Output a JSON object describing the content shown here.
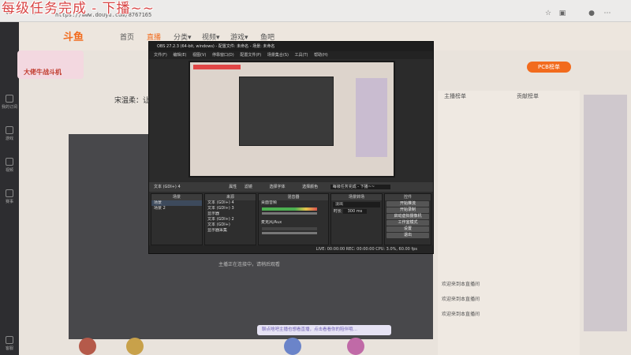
{
  "overlay": {
    "title": "每级任务完成 - 下播~~"
  },
  "browser": {
    "url": "https://www.douyu.com/8767165"
  },
  "site": {
    "logo": "斗鱼",
    "nav": [
      "首页",
      "直播",
      "分类▾",
      "视频▾",
      "游戏▾",
      "鱼吧"
    ],
    "rail": [
      "我的订阅",
      "游戏",
      "视频",
      "赛事",
      "客服"
    ],
    "streamer_name": "宋温柔：让",
    "rank_button": "PCB榜单",
    "panel_tabs": [
      "主播榜单",
      "贡献榜单"
    ],
    "stream_notice": "主播正在连接中，请稍后观看",
    "chat_input_placeholder": "聊点啥吧主播也想看直播，点击看看你的陪伴哦…",
    "chat_lines": [
      "欢迎来到本直播间",
      "欢迎来到本直播间",
      "欢迎来到本直播间"
    ],
    "badge_text": "大佬牛战斗机"
  },
  "obs": {
    "title": "OBS 27.2.3 (64-bit, windows) - 配置文件: 未命名 - 场景: 未命名",
    "menu": [
      "文件(F)",
      "编辑(E)",
      "视图(V)",
      "停靠窗口(D)",
      "配置文件(P)",
      "场景集合(S)",
      "工具(T)",
      "帮助(H)"
    ],
    "toolbar": {
      "source": "文本 (GDI+) 4",
      "props": "属性",
      "filters": "滤镜",
      "font": "选择字体",
      "text_btn": "选择颜色",
      "text_value": "每级任务完成 - 下播~~"
    },
    "docks": {
      "scenes": {
        "title": "场景",
        "items": [
          "场景",
          "场景 2"
        ]
      },
      "sources": {
        "title": "来源",
        "items": [
          "文本 (GDI+) 4",
          "文本 (GDI+) 3",
          "显示器",
          "文本 (GDI+) 2",
          "文本 (GDI+)",
          "显示器采集"
        ]
      },
      "mixer": {
        "title": "混音器",
        "tracks": [
          "桌面音频",
          "麦克风/Aux"
        ]
      },
      "transitions": {
        "title": "场景转场",
        "value": "淡出",
        "duration_label": "时长",
        "duration": "300 ms"
      },
      "controls": {
        "title": "控件",
        "buttons": [
          "开始推流",
          "开始录制",
          "启动虚拟摄像机",
          "工作室模式",
          "设置",
          "退出"
        ]
      }
    },
    "status": "LIVE: 00:00:00   REC: 00:00:00   CPU: 3.0%, 60.00 fps"
  }
}
